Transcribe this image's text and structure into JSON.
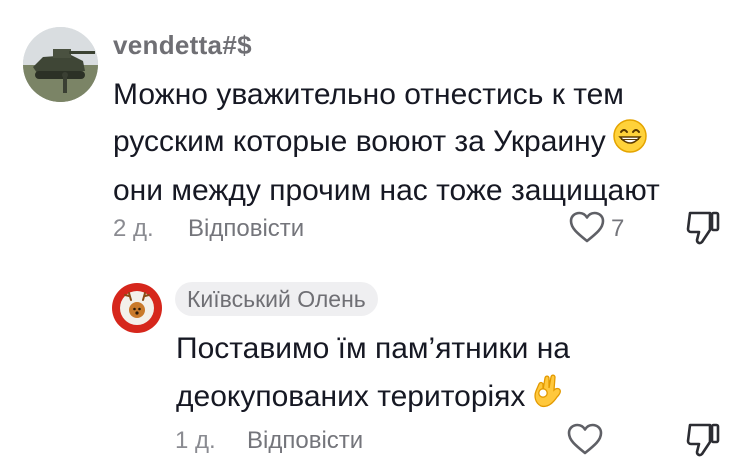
{
  "comment": {
    "username": "vendetta#$",
    "lines": [
      "Можно уважительно отнестись к тем",
      "русским которые воюют за Украину",
      "они между прочим нас тоже защищают"
    ],
    "emoji_icon": "grinning-face-with-smiling-eyes-icon",
    "date": "2 д.",
    "reply_label": "Відповісти",
    "likes": "7"
  },
  "reply": {
    "username": "Київський Олень",
    "lines": [
      "Поставимо їм пам’ятники на",
      "деокупованих територіях"
    ],
    "emoji_icon": "ok-hand-icon",
    "date": "1 д.",
    "reply_label": "Відповісти"
  },
  "colors": {
    "text": "#161823",
    "muted": "#8a8b91",
    "chip_bg": "#efeff1",
    "avatar_red": "#d6271c"
  }
}
